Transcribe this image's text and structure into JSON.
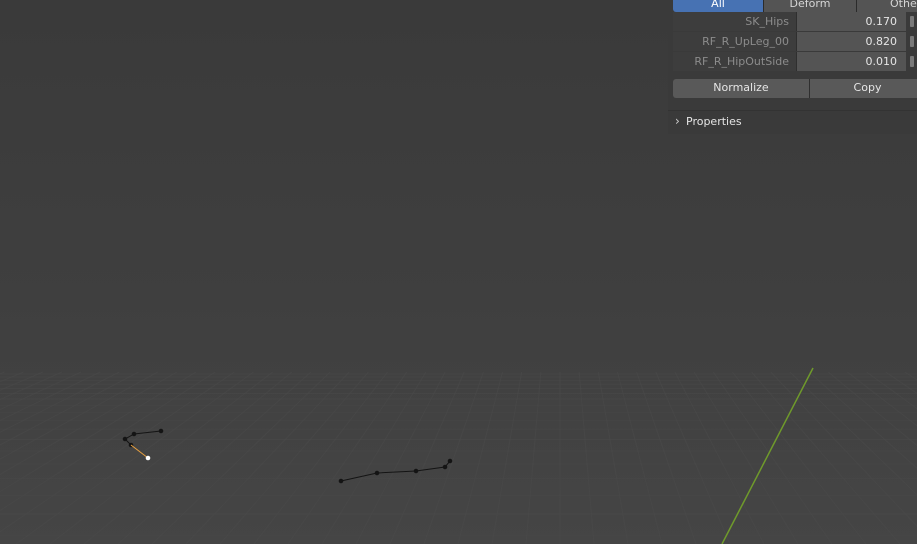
{
  "vertex_weights": {
    "filter_tabs": [
      {
        "label": "All",
        "active": true
      },
      {
        "label": "Deform",
        "active": false
      },
      {
        "label": "Other",
        "active": false
      }
    ],
    "groups": [
      {
        "name": "SK_Hips",
        "weight": "0.170"
      },
      {
        "name": "RF_R_UpLeg_00",
        "weight": "0.820"
      },
      {
        "name": "RF_R_HipOutSide",
        "weight": "0.010"
      }
    ],
    "normalize_label": "Normalize",
    "copy_label": "Copy"
  },
  "properties_panel": {
    "label": "Properties",
    "collapsed": true,
    "icon": "chevron-right-icon"
  },
  "colors": {
    "active_tab": "#4772b3",
    "y_axis": "#6f9a2b",
    "selected_bone": "#e8a040"
  }
}
